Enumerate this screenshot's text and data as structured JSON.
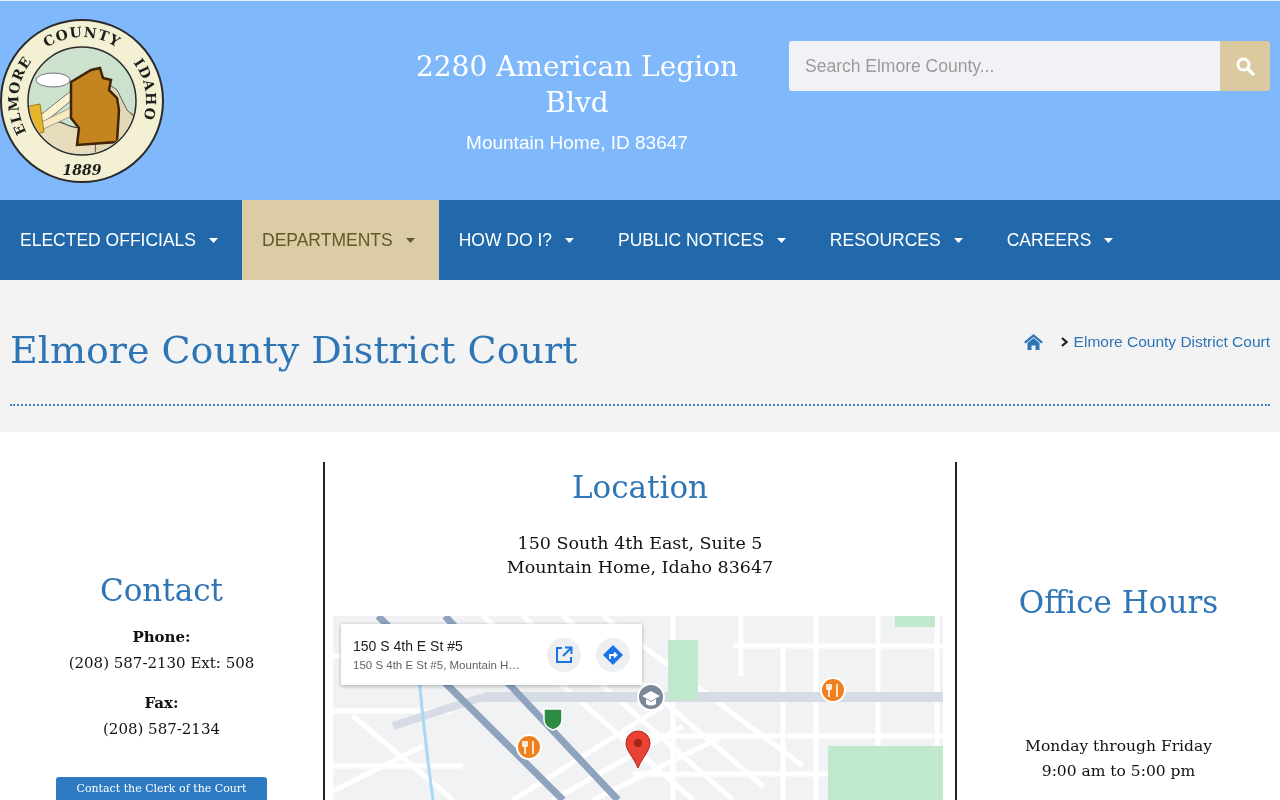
{
  "header": {
    "logo": {
      "arc_words": [
        "ELMORE",
        "COUNTY",
        "IDAHO"
      ],
      "year": "1889"
    },
    "address_line_1": "2280 American Legion Blvd",
    "address_line_2": "Mountain Home, ID 83647",
    "search": {
      "placeholder": "Search Elmore County..."
    }
  },
  "nav": [
    {
      "label": "ELECTED OFFICIALS",
      "selected": false,
      "has_dropdown": true
    },
    {
      "label": "DEPARTMENTS",
      "selected": true,
      "has_dropdown": true
    },
    {
      "label": "HOW DO I?",
      "selected": false,
      "has_dropdown": true
    },
    {
      "label": "PUBLIC NOTICES",
      "selected": false,
      "has_dropdown": true
    },
    {
      "label": "RESOURCES",
      "selected": false,
      "has_dropdown": true
    },
    {
      "label": "CAREERS",
      "selected": false,
      "has_dropdown": true
    }
  ],
  "page_title": "Elmore County District Court",
  "breadcrumb": {
    "current": "Elmore County District Court"
  },
  "contact": {
    "heading": "Contact",
    "entries": [
      {
        "label": "Phone:",
        "value": "(208) 587-2130 Ext: 508"
      },
      {
        "label": "Fax:",
        "value": "(208) 587-2134"
      }
    ],
    "button": "Contact the Clerk of the Court"
  },
  "location": {
    "heading": "Location",
    "address_lines": [
      "150 South 4th East, Suite 5",
      "Mountain Home, Idaho 83647"
    ],
    "map": {
      "place_title": "150 S 4th E St #5",
      "place_address": "150 S 4th E St #5, Mountain H…"
    }
  },
  "office_hours": {
    "heading": "Office Hours",
    "lines": [
      "Monday through Friday",
      "9:00 am to 5:00 pm"
    ]
  }
}
